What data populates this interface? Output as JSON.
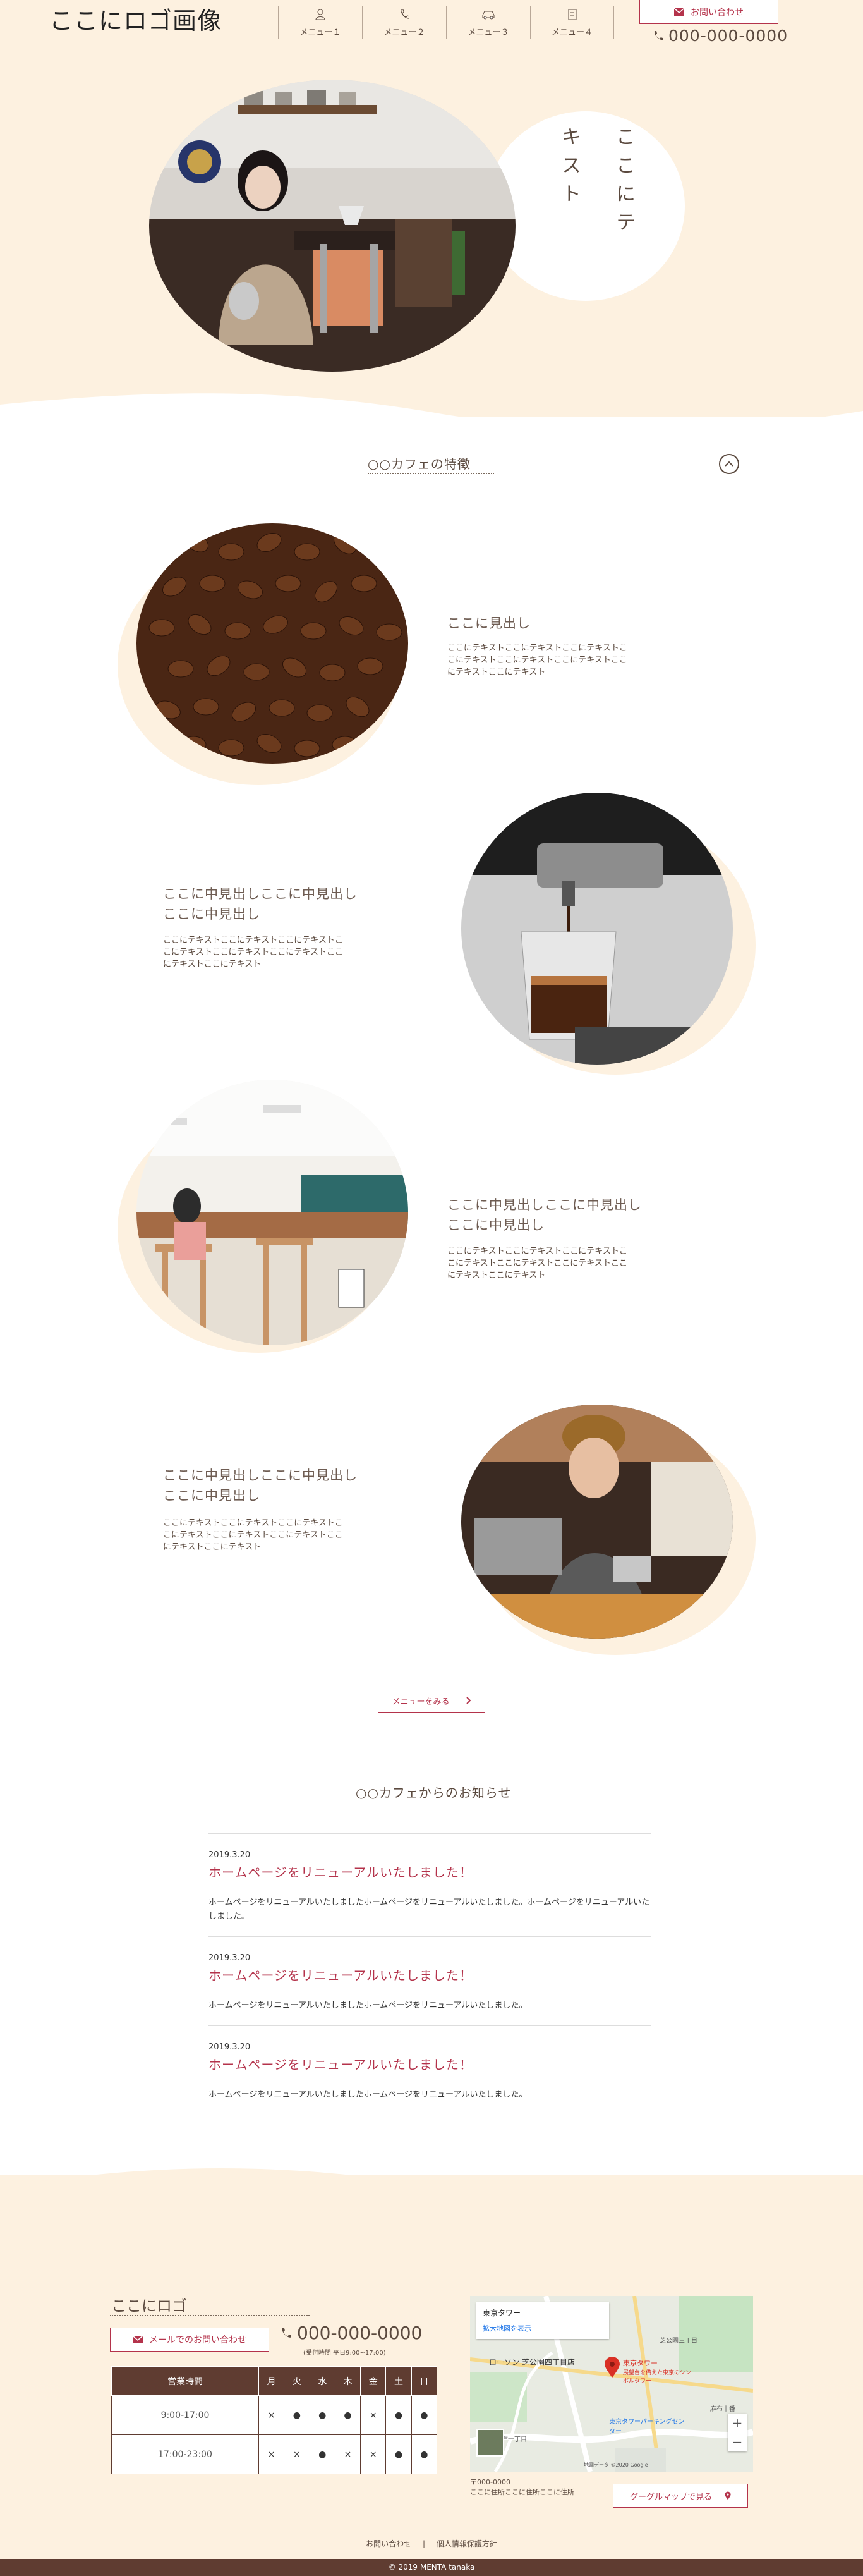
{
  "header": {
    "logo": "ここにロゴ画像",
    "nav": [
      {
        "label": "メニュー１",
        "icon": "person-icon"
      },
      {
        "label": "メニュー２",
        "icon": "phone-icon"
      },
      {
        "label": "メニュー３",
        "icon": "car-icon"
      },
      {
        "label": "メニュー４",
        "icon": "document-icon"
      }
    ],
    "contact_label": "お問い合わせ",
    "phone": "000-000-0000"
  },
  "hero": {
    "text": "ここにテキスト"
  },
  "features": {
    "title": "○○カフェの特徴",
    "items": [
      {
        "heading": "ここに見出し",
        "body": "ここにテキストここにテキストここにテキストここにテキストここにテキストここにテキストここにテキストここにテキスト"
      },
      {
        "heading": "ここに中見出しここに中見出しここに中見出し",
        "body": "ここにテキストここにテキストここにテキストここにテキストここにテキストここにテキストここにテキストここにテキスト"
      },
      {
        "heading": "ここに中見出しここに中見出しここに中見出し",
        "body": "ここにテキストここにテキストここにテキストここにテキストここにテキストここにテキストここにテキストここにテキスト"
      },
      {
        "heading": "ここに中見出しここに中見出しここに中見出し",
        "body": "ここにテキストここにテキストここにテキストここにテキストここにテキストここにテキストここにテキストここにテキスト"
      }
    ],
    "menu_button": "メニューをみる"
  },
  "news": {
    "title": "○○カフェからのお知らせ",
    "items": [
      {
        "date": "2019.3.20",
        "title": "ホームページをリニューアルいたしました！",
        "body": "ホームページをリニューアルいたしましたホームページをリニューアルいたしました。ホームページをリニューアルいたしました。"
      },
      {
        "date": "2019.3.20",
        "title": "ホームページをリニューアルいたしました！",
        "body": "ホームページをリニューアルいたしましたホームページをリニューアルいたしました。"
      },
      {
        "date": "2019.3.20",
        "title": "ホームページをリニューアルいたしました！",
        "body": "ホームページをリニューアルいたしましたホームページをリニューアルいたしました。"
      }
    ]
  },
  "footer": {
    "logo": "ここにロゴ",
    "mail_button": "メールでのお問い合わせ",
    "phone": "000-000-0000",
    "hours_note": "(受付時間 平日9:00~17:00)",
    "hours_table": {
      "headers": [
        "営業時間",
        "月",
        "火",
        "水",
        "木",
        "金",
        "土",
        "日"
      ],
      "rows": [
        [
          "9:00-17:00",
          "×",
          "●",
          "●",
          "●",
          "×",
          "●",
          "●"
        ],
        [
          "17:00-23:00",
          "×",
          "×",
          "●",
          "×",
          "×",
          "●",
          "●"
        ]
      ]
    },
    "map": {
      "place": "東京タワー",
      "enlarge": "拡大地図を表示",
      "marker_label": "東京タワー",
      "marker_sub": "展望台を備えた東京のシンボルタワー",
      "labels": [
        "芝公園三丁目",
        "ローソン 芝公園四丁目店",
        "東麻布一丁目",
        "東京タワーパーキングセンター",
        "麻布十番"
      ],
      "attribution": "地図データ ©2020 Google"
    },
    "address_zip": "〒000-0000",
    "address": "ここに住所ここに住所ここに住所",
    "gmap_button": "グーグルマップで見る",
    "links": [
      "お問い合わせ",
      "個人情報保護方針"
    ],
    "link_separator": "|",
    "copyright": "© 2019 MENTA tanaka"
  },
  "colors": {
    "cream": "#fdf1e0",
    "brown": "#5f3c31",
    "accent": "#b4334b",
    "text": "#5b4a3f"
  }
}
